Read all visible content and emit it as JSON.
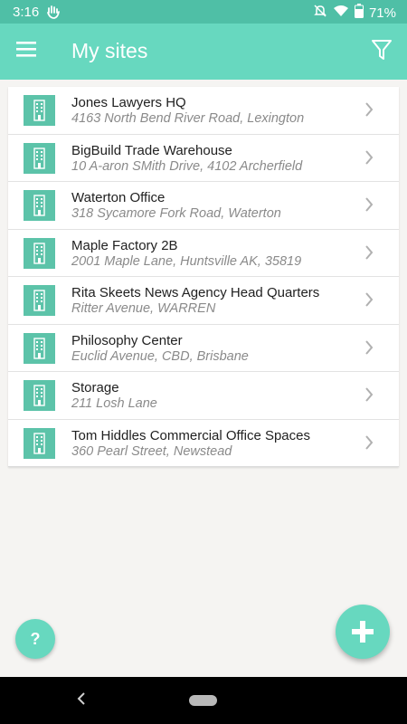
{
  "status_bar": {
    "time": "3:16",
    "battery": "71%",
    "icons": [
      "gesture-notification-icon",
      "do-not-disturb-off-icon",
      "wifi-icon",
      "battery-icon"
    ]
  },
  "app_bar": {
    "title": "My sites",
    "menu_icon": "menu-icon",
    "filter_icon": "filter-icon"
  },
  "sites": [
    {
      "name": "Jones Lawyers HQ",
      "address": "4163 North Bend River Road, Lexington"
    },
    {
      "name": "BigBuild Trade Warehouse",
      "address": "10 A-aron SMith Drive, 4102 Archerfield"
    },
    {
      "name": "Waterton Office",
      "address": "318 Sycamore Fork Road, Waterton"
    },
    {
      "name": "Maple Factory 2B",
      "address": "2001 Maple Lane, Huntsville AK, 35819"
    },
    {
      "name": "Rita Skeets News Agency Head Quarters",
      "address": "Ritter Avenue, WARREN"
    },
    {
      "name": "Philosophy Center",
      "address": "Euclid Avenue, CBD, Brisbane"
    },
    {
      "name": "Storage",
      "address": "211 Losh Lane"
    },
    {
      "name": "Tom Hiddles Commercial Office Spaces",
      "address": "360 Pearl Street, Newstead"
    }
  ],
  "help_button": {
    "label": "?"
  },
  "add_button": {
    "icon": "plus-icon"
  },
  "colors": {
    "accent": "#67d8bf",
    "status_bar": "#4fbfa6",
    "site_icon": "#5cc3a9",
    "background": "#f5f4f2"
  }
}
